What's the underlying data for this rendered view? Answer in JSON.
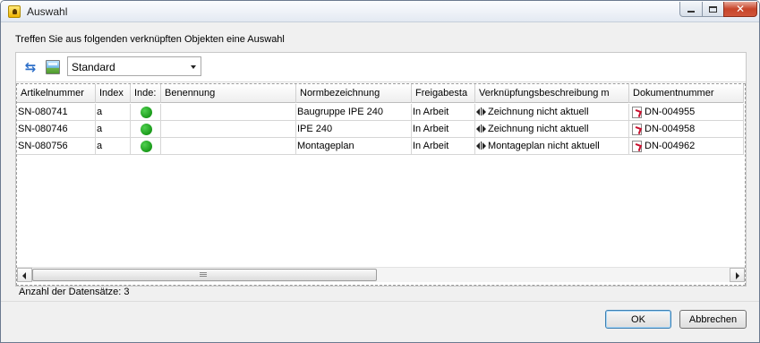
{
  "window": {
    "title": "Auswahl",
    "close_glyph": "✕"
  },
  "instruction": "Treffen Sie aus folgenden verknüpften Objekten eine Auswahl",
  "toolbar": {
    "refresh_icon": "refresh-arrows-icon",
    "layout_icon": "layout-image-icon",
    "view_select_value": "Standard"
  },
  "grid": {
    "columns": [
      "Artikelnummer",
      "Index",
      "Inde:",
      "Benennung",
      "Normbezeichnung",
      "Freigabesta",
      "Verknüpfungsbeschreibung m",
      "Dokumentnummer"
    ],
    "rows": [
      {
        "artikelnummer": "SN-080741",
        "index": "a",
        "status_color": "#1a9a1a",
        "benennung": "",
        "normbezeichnung": "Baugruppe IPE 240",
        "freigabestatus": "In Arbeit",
        "verknuepfung": "Zeichnung nicht aktuell",
        "dokumentnummer": "DN-004955"
      },
      {
        "artikelnummer": "SN-080746",
        "index": "a",
        "status_color": "#1a9a1a",
        "benennung": "",
        "normbezeichnung": "IPE 240",
        "freigabestatus": "In Arbeit",
        "verknuepfung": "Zeichnung nicht aktuell",
        "dokumentnummer": "DN-004958"
      },
      {
        "artikelnummer": "SN-080756",
        "index": "a",
        "status_color": "#1a9a1a",
        "benennung": "",
        "normbezeichnung": "Montageplan",
        "freigabestatus": "In Arbeit",
        "verknuepfung": "Montageplan nicht aktuell",
        "dokumentnummer": "DN-004962"
      }
    ]
  },
  "record_count": "Anzahl der Datensätze: 3",
  "buttons": {
    "ok": "OK",
    "cancel": "Abbrechen"
  }
}
